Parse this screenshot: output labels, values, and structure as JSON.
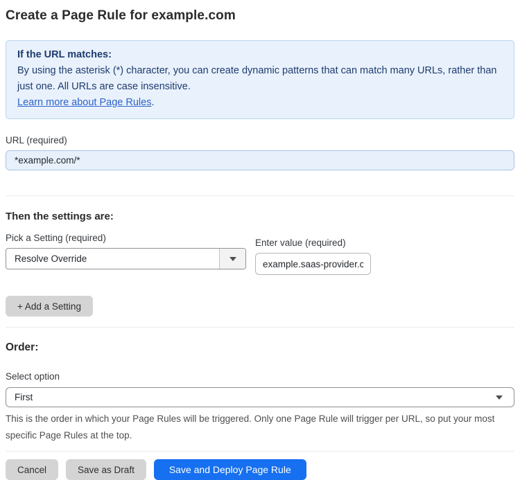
{
  "page": {
    "title": "Create a Page Rule for example.com"
  },
  "info_box": {
    "heading": "If the URL matches:",
    "body": "By using the asterisk (*) character, you can create dynamic patterns that can match many URLs, rather than just one. All URLs are case insensitive.",
    "link_label": "Learn more about Page Rules",
    "link_suffix": "."
  },
  "url_field": {
    "label": "URL (required)",
    "value": "*example.com/*"
  },
  "settings_section": {
    "heading": "Then the settings are:",
    "setting_picker": {
      "label": "Pick a Setting (required)",
      "selected": "Resolve Override"
    },
    "value_field": {
      "label": "Enter value (required)",
      "value": "example.saas-provider.c"
    },
    "add_setting_label": "+ Add a Setting"
  },
  "order_section": {
    "heading": "Order:",
    "select_label": "Select option",
    "selected": "First",
    "help_text": "This is the order in which your Page Rules will be triggered. Only one Page Rule will trigger per URL, so put your most specific Page Rules at the top."
  },
  "footer": {
    "cancel_label": "Cancel",
    "save_draft_label": "Save as Draft",
    "save_deploy_label": "Save and Deploy Page Rule"
  },
  "colors": {
    "info_background": "#e9f1fc",
    "info_border": "#b8d4f3",
    "info_text": "#1e3c6e",
    "link": "#2b63c9",
    "url_input_background": "#e8f0fc",
    "url_input_border": "#a9c3e6",
    "primary_button": "#1670f0",
    "gray_button": "#d4d4d4"
  }
}
